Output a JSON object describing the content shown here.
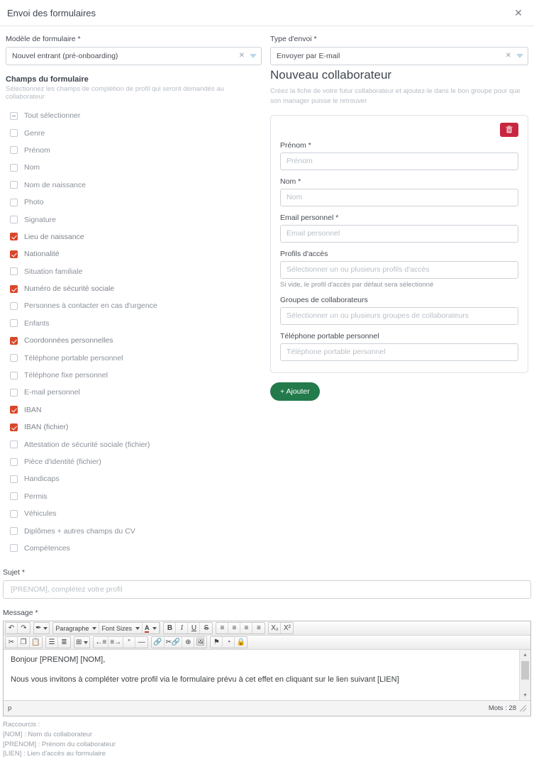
{
  "header": {
    "title": "Envoi des formulaires",
    "close_label": "✕"
  },
  "top_fields": {
    "template": {
      "label": "Modèle de formulaire *",
      "value": "Nouvel entrant (pré-onboarding)",
      "clear": "✕"
    },
    "send_type": {
      "label": "Type d'envoi *",
      "value": "Envoyer par E-mail",
      "clear": "✕"
    }
  },
  "form_fields_section": {
    "title": "Champs du formulaire",
    "subtitle": "Sélectionnez les champs de complétion de profil qui seront demandés au collaborateur",
    "items": [
      {
        "label": "Tout sélectionner",
        "state": "indeterminate"
      },
      {
        "label": "Genre",
        "state": "unchecked"
      },
      {
        "label": "Prénom",
        "state": "unchecked"
      },
      {
        "label": "Nom",
        "state": "unchecked"
      },
      {
        "label": "Nom de naissance",
        "state": "unchecked"
      },
      {
        "label": "Photo",
        "state": "unchecked"
      },
      {
        "label": "Signature",
        "state": "unchecked"
      },
      {
        "label": "Lieu de naissance",
        "state": "checked"
      },
      {
        "label": "Nationalité",
        "state": "checked"
      },
      {
        "label": "Situation familiale",
        "state": "unchecked"
      },
      {
        "label": "Numéro de sécurité sociale",
        "state": "checked"
      },
      {
        "label": "Personnes à contacter en cas d'urgence",
        "state": "unchecked"
      },
      {
        "label": "Enfants",
        "state": "unchecked"
      },
      {
        "label": "Coordonnées personnelles",
        "state": "checked"
      },
      {
        "label": "Téléphone portable personnel",
        "state": "unchecked"
      },
      {
        "label": "Téléphone fixe personnel",
        "state": "unchecked"
      },
      {
        "label": "E-mail personnel",
        "state": "unchecked"
      },
      {
        "label": "IBAN",
        "state": "checked"
      },
      {
        "label": "IBAN (fichier)",
        "state": "checked"
      },
      {
        "label": "Attestation de sécurité sociale (fichier)",
        "state": "unchecked"
      },
      {
        "label": "Pièce d'identité (fichier)",
        "state": "unchecked"
      },
      {
        "label": "Handicaps",
        "state": "unchecked"
      },
      {
        "label": "Permis",
        "state": "unchecked"
      },
      {
        "label": "Véhicules",
        "state": "unchecked"
      },
      {
        "label": "Diplômes + autres champs du CV",
        "state": "unchecked"
      },
      {
        "label": "Compétences",
        "state": "unchecked"
      }
    ]
  },
  "right_panel": {
    "title": "Nouveau collaborateur",
    "subtitle": "Créez la fiche de votre futur collaborateur et ajoutez-le dans le bon groupe pour que son manager puisse le retrouver",
    "delete_icon": "trash-icon",
    "fields": [
      {
        "label": "Prénom *",
        "placeholder": "Prénom",
        "value": ""
      },
      {
        "label": "Nom *",
        "placeholder": "Nom",
        "value": ""
      },
      {
        "label": "Email personnel *",
        "placeholder": "Email personnel",
        "value": ""
      },
      {
        "label": "Profils d'accès",
        "placeholder": "Sélectionner un ou plusieurs profils d'accès",
        "value": "",
        "hint": "Si vide, le profil d'accès par défaut sera sélectionné"
      },
      {
        "label": "Groupes de collaborateurs",
        "placeholder": "Sélectionner un ou plusieurs groupes de collaborateurs",
        "value": ""
      },
      {
        "label": "Téléphone portable personnel",
        "placeholder": "Téléphone portable personnel",
        "value": ""
      }
    ],
    "add_button": "+ Ajouter"
  },
  "subject": {
    "label": "Sujet *",
    "placeholder": "[PRENOM], complétez votre profil",
    "value": ""
  },
  "message": {
    "label": "Message *",
    "toolbar_row1": {
      "undo": "↶",
      "redo": "↷",
      "spellcheck": "✒",
      "paragraph_select": "Paragraphe",
      "fontsize_select": "Font Sizes",
      "textcolor": "A",
      "bold": "B",
      "italic": "I",
      "underline": "U",
      "strikethrough": "S",
      "align_left": "≡",
      "align_center": "≡",
      "align_right": "≡",
      "align_justify": "≡",
      "subscript": "X₂",
      "superscript": "X²"
    },
    "toolbar_row2": {
      "cut": "✂",
      "copy": "❐",
      "paste": "📋",
      "bullet_list": "☰",
      "numbered_list": "≣",
      "table": "⊞",
      "outdent": "←≡",
      "indent": "≡→",
      "blockquote": "“",
      "horizontal_rule": "—",
      "link": "🔗",
      "unlink": "✂🔗",
      "anchor": "⊕",
      "image": "🖼",
      "flag": "⚑",
      "clock": "◔",
      "lock": "🔒"
    },
    "body_lines": [
      "Bonjour [PRENOM] [NOM],",
      "Nous vous invitons à compléter votre profil via le formulaire prévu à cet effet en cliquant sur le lien suivant [LIEN]"
    ],
    "status_path": "p",
    "word_count": "Mots : 28"
  },
  "shortcuts": {
    "title": "Raccourcis :",
    "items": [
      "[NOM] : Nom du collaborateur",
      "[PRENOM] : Prénom du collaborateur",
      "[LIEN] : Lien d'accès au formulaire"
    ]
  },
  "colors": {
    "checkbox_checked": "#d9472b",
    "delete_button": "#c8263f",
    "add_button": "#237a4b"
  }
}
